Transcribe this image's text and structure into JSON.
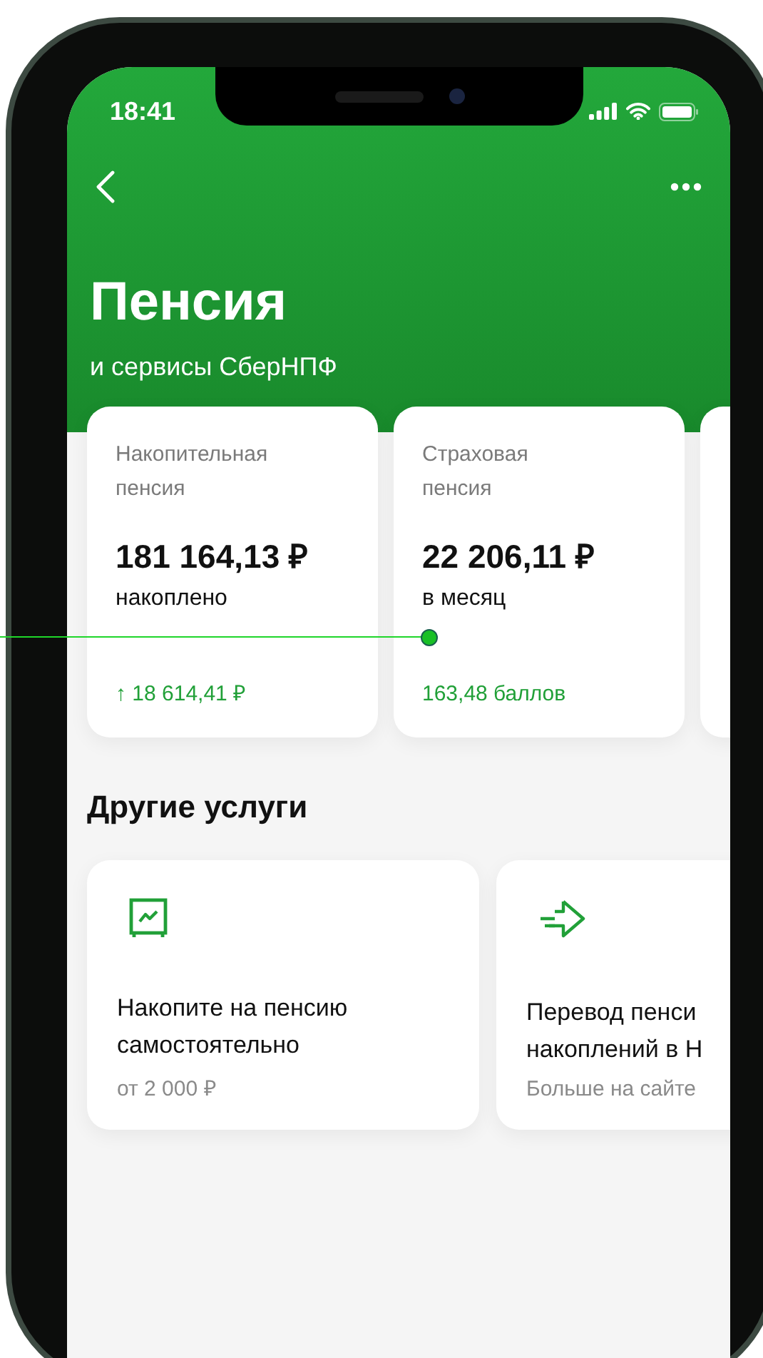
{
  "status_bar": {
    "time": "18:41"
  },
  "header": {
    "title": "Пенсия",
    "subtitle": "и сервисы СберНПФ"
  },
  "pension_cards": [
    {
      "title": "Накопительная пенсия",
      "amount": "181 164,13 ₽",
      "caption": "накоплено",
      "note": "↑ 18 614,41 ₽"
    },
    {
      "title": "Страховая пенсия",
      "amount": "22 206,11 ₽",
      "caption": "в месяц",
      "note": "163,48 баллов"
    }
  ],
  "services_title": "Другие услуги",
  "services": [
    {
      "kind": "chart",
      "title_lines": [
        "Накопите на пенсию",
        "самостоятельно"
      ],
      "note": "от 2 000 ₽"
    },
    {
      "kind": "transfer",
      "title_lines": [
        "Перевод пенси",
        "накоплений в Н"
      ],
      "note": "Больше на сайте"
    }
  ]
}
